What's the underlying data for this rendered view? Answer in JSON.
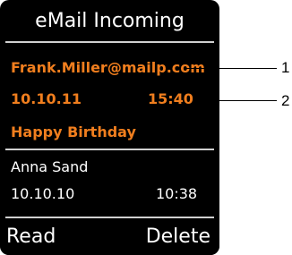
{
  "screen": {
    "title": "eMail Incoming"
  },
  "messages": [
    {
      "sender": "Frank.Miller@mailp.com",
      "date": "10.10.11",
      "time": "15:40",
      "subject": "Happy Birthday",
      "selected": true
    },
    {
      "sender": "Anna Sand",
      "date": "10.10.10",
      "time": "10:38",
      "selected": false
    }
  ],
  "softkeys": {
    "left": "Read",
    "right": "Delete"
  },
  "callouts": [
    "1",
    "2"
  ],
  "colors": {
    "screen_background": "#000000",
    "highlight": "#f07e1e",
    "text": "#ffffff",
    "divider": "#d0d0d0"
  }
}
